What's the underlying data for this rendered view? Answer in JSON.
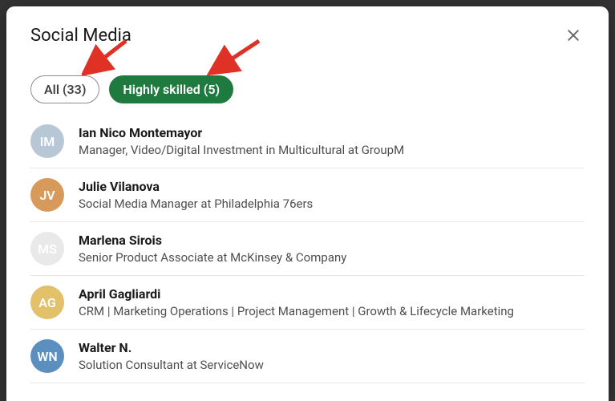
{
  "modal": {
    "title": "Social Media"
  },
  "filters": {
    "all": {
      "label": "All (33)",
      "active": false
    },
    "highly_skilled": {
      "label": "Highly skilled (5)",
      "active": true
    }
  },
  "annotations": {
    "arrow_color": "#e03126"
  },
  "endorsers": [
    {
      "name": "Ian Nico Montemayor",
      "headline": "Manager, Video/Digital Investment in Multicultural at GroupM",
      "avatar_bg": "#b8c7d6",
      "avatar_initials": "IM"
    },
    {
      "name": "Julie Vilanova",
      "headline": "Social Media Manager at Philadelphia 76ers",
      "avatar_bg": "#d79a5b",
      "avatar_initials": "JV"
    },
    {
      "name": "Marlena Sirois",
      "headline": "Senior Product Associate at McKinsey & Company",
      "avatar_bg": "#e9e9e9",
      "avatar_initials": "MS"
    },
    {
      "name": "April Gagliardi",
      "headline": "CRM | Marketing Operations | Project Management | Growth & Lifecycle Marketing",
      "avatar_bg": "#e3c06a",
      "avatar_initials": "AG"
    },
    {
      "name": "Walter N.",
      "headline": "Solution Consultant at ServiceNow",
      "avatar_bg": "#5a8fbf",
      "avatar_initials": "WN"
    }
  ]
}
